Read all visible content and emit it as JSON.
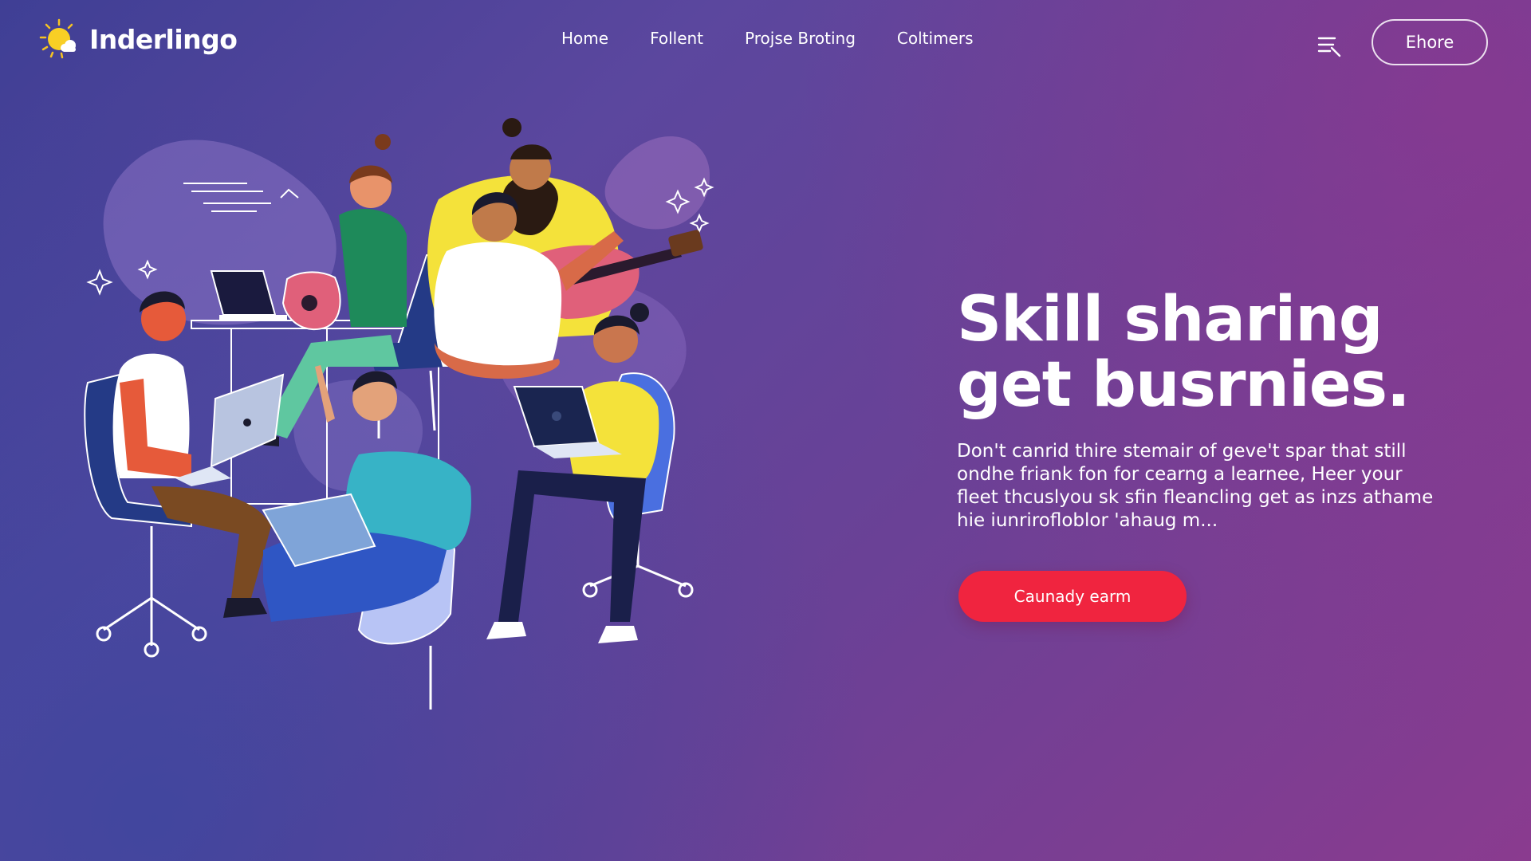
{
  "brand": {
    "name": "Inderlingo",
    "logo_icon": "sun-cloud-icon"
  },
  "nav": {
    "items": [
      "Home",
      "Follent",
      "Projse Broting",
      "Coltimers"
    ]
  },
  "header": {
    "menu_icon": "hamburger-menu-icon",
    "button_label": "Ehore"
  },
  "hero": {
    "title_lines": [
      "Skill sharing",
      "get busrnies."
    ],
    "body_lines": [
      "Don't canrid thire stemair of geve't spar that still",
      "ondhe friank fon for cearng a learnee, Heer your",
      "fleet thcuslyou sk sfin fleancling get as inzs athame",
      "hie iunrirofloblor 'ahaug m..."
    ],
    "cta_label": "Caunady earm"
  },
  "colors": {
    "background_start": "#3f3f95",
    "background_end": "#8a3b8f",
    "cta": "#f0243f",
    "accent_yellow": "#f5e23a"
  },
  "illustration": {
    "description_icons": [
      "people-collaborating-illustration",
      "guitar-icon",
      "laptop-icon",
      "sparkle-icon"
    ]
  }
}
